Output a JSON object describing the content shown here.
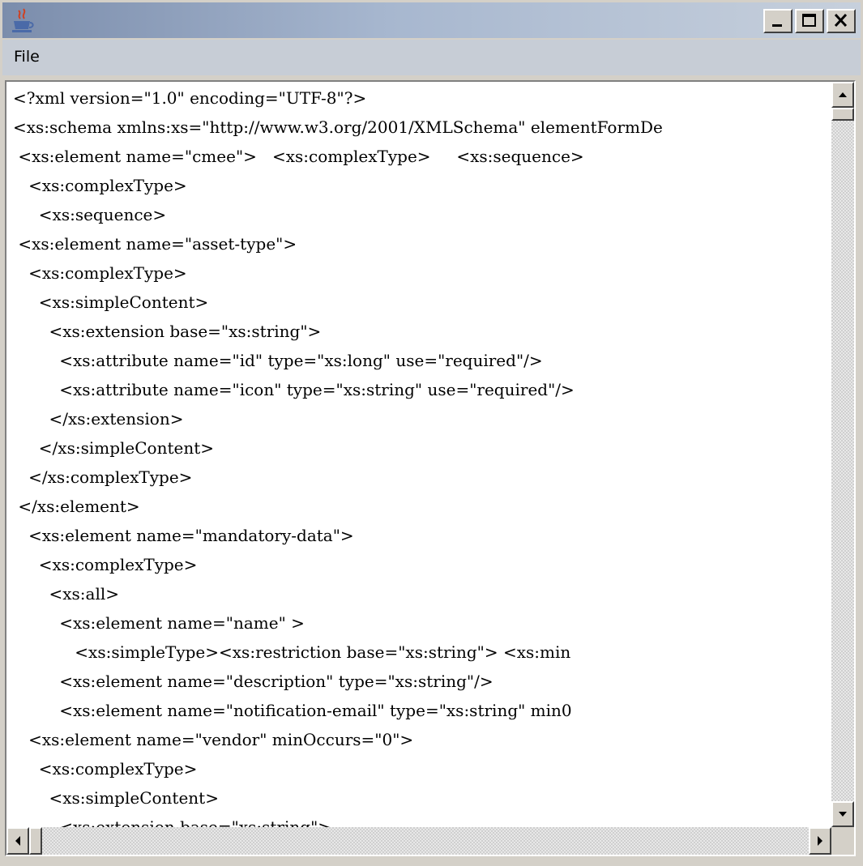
{
  "window": {
    "title": "",
    "icon": "java-cup-icon",
    "controls": [
      "minimize-icon",
      "maximize-icon",
      "close-icon"
    ]
  },
  "menubar": {
    "items": [
      {
        "label": "File"
      }
    ]
  },
  "editor": {
    "lines": [
      "<?xml version=\"1.0\" encoding=\"UTF-8\"?>",
      "<xs:schema xmlns:xs=\"http://www.w3.org/2001/XMLSchema\" elementFormDe",
      " <xs:element name=\"cmee\">   <xs:complexType>     <xs:sequence>",
      "   <xs:complexType>",
      "     <xs:sequence>",
      " <xs:element name=\"asset-type\">",
      "   <xs:complexType>",
      "     <xs:simpleContent>",
      "       <xs:extension base=\"xs:string\">",
      "         <xs:attribute name=\"id\" type=\"xs:long\" use=\"required\"/>",
      "         <xs:attribute name=\"icon\" type=\"xs:string\" use=\"required\"/>",
      "       </xs:extension>",
      "     </xs:simpleContent>",
      "   </xs:complexType>",
      " </xs:element>",
      "   <xs:element name=\"mandatory-data\">",
      "     <xs:complexType>",
      "       <xs:all>",
      "         <xs:element name=\"name\" >",
      "            <xs:simpleType><xs:restriction base=\"xs:string\"> <xs:min",
      "         <xs:element name=\"description\" type=\"xs:string\"/>",
      "         <xs:element name=\"notification-email\" type=\"xs:string\" min0",
      "   <xs:element name=\"vendor\" minOccurs=\"0\">",
      "     <xs:complexType>",
      "       <xs:simpleContent>",
      "         <xs:extension base=\"xs:string\">"
    ]
  },
  "scrollbars": {
    "vertical": {
      "up": "arrow-up-icon",
      "down": "arrow-down-icon"
    },
    "horizontal": {
      "left": "arrow-left-icon",
      "right": "arrow-right-icon"
    }
  }
}
